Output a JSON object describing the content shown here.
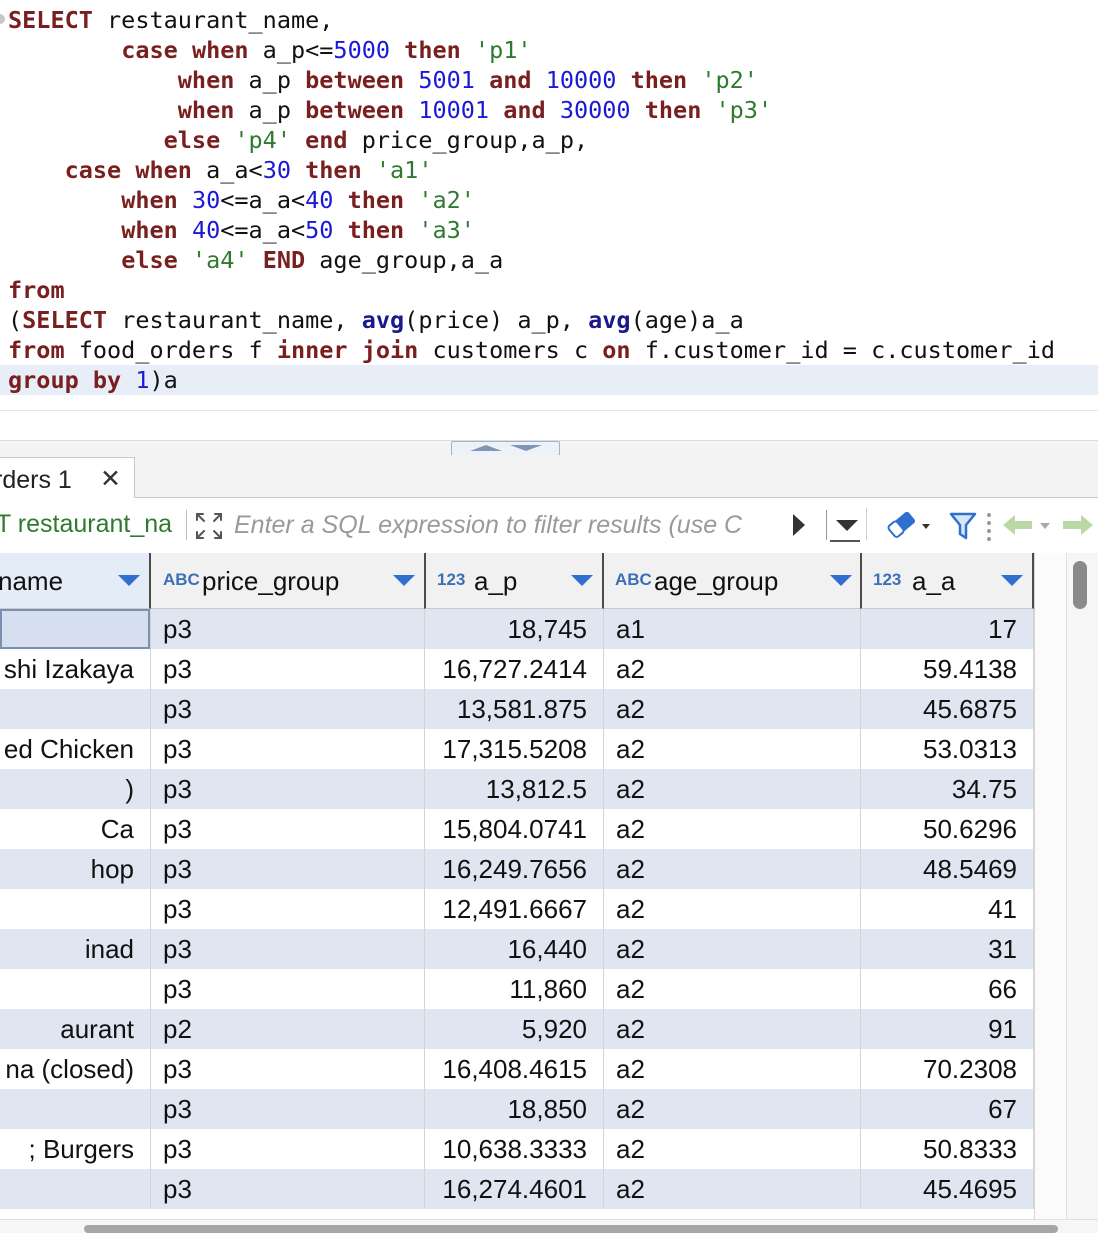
{
  "editor": {
    "lines": [
      [
        [
          "kw",
          "SELECT"
        ],
        [
          "t",
          " restaurant_name,"
        ]
      ],
      [
        [
          "t",
          "        "
        ],
        [
          "kw",
          "case"
        ],
        [
          "t",
          " "
        ],
        [
          "kw",
          "when"
        ],
        [
          "t",
          " a_p<="
        ],
        [
          "num",
          "5000"
        ],
        [
          "t",
          " "
        ],
        [
          "kw",
          "then"
        ],
        [
          "t",
          " "
        ],
        [
          "str",
          "'p1'"
        ]
      ],
      [
        [
          "t",
          "            "
        ],
        [
          "kw",
          "when"
        ],
        [
          "t",
          " a_p "
        ],
        [
          "kw",
          "between"
        ],
        [
          "t",
          " "
        ],
        [
          "num",
          "5001"
        ],
        [
          "t",
          " "
        ],
        [
          "kw",
          "and"
        ],
        [
          "t",
          " "
        ],
        [
          "num",
          "10000"
        ],
        [
          "t",
          " "
        ],
        [
          "kw",
          "then"
        ],
        [
          "t",
          " "
        ],
        [
          "str",
          "'p2'"
        ]
      ],
      [
        [
          "t",
          "            "
        ],
        [
          "kw",
          "when"
        ],
        [
          "t",
          " a_p "
        ],
        [
          "kw",
          "between"
        ],
        [
          "t",
          " "
        ],
        [
          "num",
          "10001"
        ],
        [
          "t",
          " "
        ],
        [
          "kw",
          "and"
        ],
        [
          "t",
          " "
        ],
        [
          "num",
          "30000"
        ],
        [
          "t",
          " "
        ],
        [
          "kw",
          "then"
        ],
        [
          "t",
          " "
        ],
        [
          "str",
          "'p3'"
        ]
      ],
      [
        [
          "t",
          "           "
        ],
        [
          "kw",
          "else"
        ],
        [
          "t",
          " "
        ],
        [
          "str",
          "'p4'"
        ],
        [
          "t",
          " "
        ],
        [
          "kw",
          "end"
        ],
        [
          "t",
          " price_group,a_p,"
        ]
      ],
      [
        [
          "t",
          "    "
        ],
        [
          "kw",
          "case"
        ],
        [
          "t",
          " "
        ],
        [
          "kw",
          "when"
        ],
        [
          "t",
          " a_a<"
        ],
        [
          "num",
          "30"
        ],
        [
          "t",
          " "
        ],
        [
          "kw",
          "then"
        ],
        [
          "t",
          " "
        ],
        [
          "str",
          "'a1'"
        ]
      ],
      [
        [
          "t",
          "        "
        ],
        [
          "kw",
          "when"
        ],
        [
          "t",
          " "
        ],
        [
          "num",
          "30"
        ],
        [
          "t",
          "<=a_a<"
        ],
        [
          "num",
          "40"
        ],
        [
          "t",
          " "
        ],
        [
          "kw",
          "then"
        ],
        [
          "t",
          " "
        ],
        [
          "str",
          "'a2'"
        ]
      ],
      [
        [
          "t",
          "        "
        ],
        [
          "kw",
          "when"
        ],
        [
          "t",
          " "
        ],
        [
          "num",
          "40"
        ],
        [
          "t",
          "<=a_a<"
        ],
        [
          "num",
          "50"
        ],
        [
          "t",
          " "
        ],
        [
          "kw",
          "then"
        ],
        [
          "t",
          " "
        ],
        [
          "str",
          "'a3'"
        ]
      ],
      [
        [
          "t",
          "        "
        ],
        [
          "kw",
          "else"
        ],
        [
          "t",
          " "
        ],
        [
          "str",
          "'a4'"
        ],
        [
          "t",
          " "
        ],
        [
          "kw",
          "END"
        ],
        [
          "t",
          " age_group,a_a"
        ]
      ],
      [
        [
          "kw",
          "from"
        ]
      ],
      [
        [
          "t",
          "("
        ],
        [
          "kw",
          "SELECT"
        ],
        [
          "t",
          " restaurant_name, "
        ],
        [
          "fn",
          "avg"
        ],
        [
          "t",
          "(price) a_p, "
        ],
        [
          "fn",
          "avg"
        ],
        [
          "t",
          "(age)a_a"
        ]
      ],
      [
        [
          "kw",
          "from"
        ],
        [
          "t",
          " food_orders f "
        ],
        [
          "kw",
          "inner"
        ],
        [
          "t",
          " "
        ],
        [
          "kw",
          "join"
        ],
        [
          "t",
          " customers c "
        ],
        [
          "kw",
          "on"
        ],
        [
          "t",
          " f.customer_id = c.customer_id"
        ]
      ],
      [
        [
          "kw",
          "group"
        ],
        [
          "t",
          " "
        ],
        [
          "kw",
          "by"
        ],
        [
          "t",
          " "
        ],
        [
          "num",
          "1"
        ],
        [
          "t",
          ")a"
        ]
      ]
    ]
  },
  "result_tab": {
    "label": "rders 1",
    "close_icon": "close-icon"
  },
  "filter": {
    "prefix": "T restaurant_na",
    "placeholder": "Enter a SQL expression to filter results (use C"
  },
  "grid": {
    "columns": [
      {
        "type": "",
        "name": "name"
      },
      {
        "type": "ABC",
        "name": "price_group"
      },
      {
        "type": "123",
        "name": "a_p"
      },
      {
        "type": "ABC",
        "name": "age_group"
      },
      {
        "type": "123",
        "name": "a_a"
      }
    ],
    "rows": [
      [
        "",
        "p3",
        "18,745",
        "a1",
        "17"
      ],
      [
        "shi Izakaya",
        "p3",
        "16,727.2414",
        "a2",
        "59.4138"
      ],
      [
        "",
        "p3",
        "13,581.875",
        "a2",
        "45.6875"
      ],
      [
        "ed Chicken",
        "p3",
        "17,315.5208",
        "a2",
        "53.0313"
      ],
      [
        ")",
        "p3",
        "13,812.5",
        "a2",
        "34.75"
      ],
      [
        "Ca",
        "p3",
        "15,804.0741",
        "a2",
        "50.6296"
      ],
      [
        "hop",
        "p3",
        "16,249.7656",
        "a2",
        "48.5469"
      ],
      [
        "",
        "p3",
        "12,491.6667",
        "a2",
        "41"
      ],
      [
        "inad",
        "p3",
        "16,440",
        "a2",
        "31"
      ],
      [
        "",
        "p3",
        "11,860",
        "a2",
        "66"
      ],
      [
        "aurant",
        "p2",
        "5,920",
        "a2",
        "91"
      ],
      [
        "na (closed)",
        "p3",
        "16,408.4615",
        "a2",
        "70.2308"
      ],
      [
        "",
        "p3",
        "18,850",
        "a2",
        "67"
      ],
      [
        "; Burgers",
        "p3",
        "10,638.3333",
        "a2",
        "50.8333"
      ],
      [
        "",
        "p3",
        "16,274.4601",
        "a2",
        "45.4695"
      ]
    ]
  },
  "colors": {
    "keyword": "#7a1f1f",
    "number": "#1a1ad6",
    "string": "#2f7a2f",
    "row_alt": "#dfe6f1",
    "sort_arrow": "#2f6fcf"
  }
}
